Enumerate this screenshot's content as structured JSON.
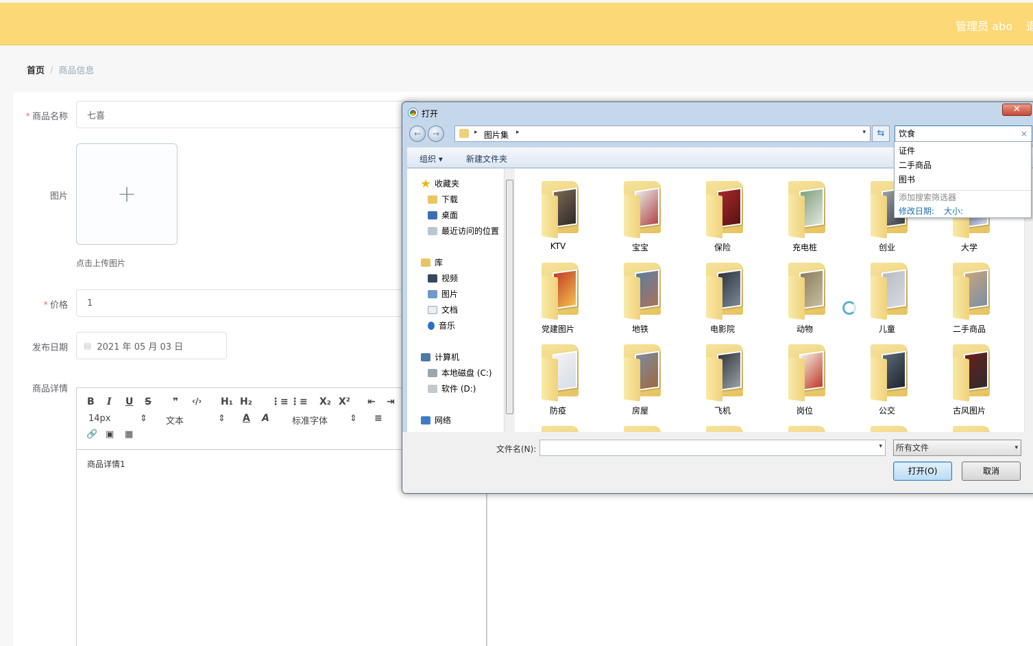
{
  "header": {
    "admin_label": "管理员 abo",
    "logout_label": "退"
  },
  "breadcrumb": {
    "home": "首页",
    "separator": "/",
    "current": "商品信息"
  },
  "form": {
    "name_label": "商品名称",
    "name_value": "七喜",
    "image_label": "图片",
    "upload_tip": "点击上传图片",
    "upload_plus": "+",
    "price_label": "价格",
    "price_value": "1",
    "date_label": "发布日期",
    "date_value": "2021 年 05 月 03 日",
    "date_icon": "▤",
    "detail_label": "商品详情",
    "required_mark": "*"
  },
  "editor": {
    "bold": "B",
    "italic": "I",
    "underline": "U",
    "strike": "S",
    "quote": "❞",
    "code": "‹/›",
    "h1": "H₁",
    "h2": "H₂",
    "ol": "⋮≡",
    "ul": "⋮≡",
    "sub": "X₂",
    "sup": "X²",
    "outdent": "⇤",
    "indent": "⇥",
    "font_size": "14px",
    "block_type": "文本",
    "color": "A",
    "bg_color": "A",
    "font_family": "标准字体",
    "align": "≡",
    "sel_arrows": "⇕",
    "link": "🔗",
    "image": "▣",
    "video": "▦",
    "content": "商品详情1"
  },
  "dialog": {
    "title": "打开",
    "close": "✕",
    "address_path": "图片集",
    "address_caret": "▸",
    "dropdown_caret": "▾",
    "back_arrow": "←",
    "forward_arrow": "→",
    "refresh": "⇆",
    "search_value": "饮食",
    "search_clear": "×",
    "organize": "组织 ▾",
    "new_folder": "新建文件夹",
    "nav": {
      "favorites": "收藏夹",
      "downloads": "下载",
      "desktop": "桌面",
      "recent": "最近访问的位置",
      "libraries": "库",
      "videos": "视频",
      "pictures": "图片",
      "documents": "文档",
      "music": "音乐",
      "computer": "计算机",
      "local_c": "本地磁盘 (C:)",
      "soft_d": "软件 (D:)",
      "network": "网络"
    },
    "folders": [
      "KTV",
      "宝宝",
      "保险",
      "充电桩",
      "创业",
      "大学",
      "党建图片",
      "地铁",
      "电影院",
      "动物",
      "儿童",
      "二手商品",
      "防疫",
      "房屋",
      "飞机",
      "岗位",
      "公交",
      "古风图片"
    ],
    "filename_label": "文件名(N):",
    "filename_value": "",
    "file_type": "所有文件",
    "open_button": "打开(O)",
    "cancel_button": "取消",
    "suggestions": [
      "证件",
      "二手商品",
      "图书"
    ],
    "add_filter_hint": "添加搜索筛选器",
    "filter_date": "修改日期:",
    "filter_size": "大小:"
  }
}
